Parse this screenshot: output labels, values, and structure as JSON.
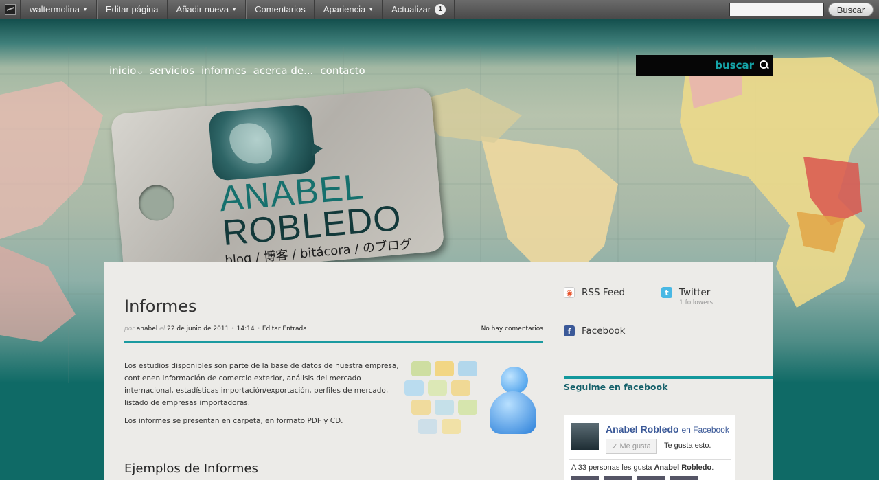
{
  "adminbar": {
    "user": "waltermolina",
    "items": [
      "Editar página",
      "Añadir nueva",
      "Comentarios",
      "Apariencia",
      "Actualizar"
    ],
    "update_count": "1",
    "search_button": "Buscar"
  },
  "nav": {
    "items": [
      "inicio",
      "servicios",
      "informes",
      "acerca de...",
      "contacto"
    ]
  },
  "search": {
    "label": "buscar"
  },
  "logo": {
    "line1": "ANABEL",
    "line2": "ROBLEDO",
    "tagline": "blog / 博客 / bitácora / のブログ"
  },
  "post": {
    "title": "Informes",
    "meta_by": "por",
    "author": "anabel",
    "meta_el": "el",
    "date": "22 de junio de 2011",
    "time": "14:14",
    "edit": "Editar Entrada",
    "comments": "No hay comentarios",
    "paragraph1": "Los estudios disponibles son parte de la base de datos de nuestra empresa, contienen información de comercio exterior, análisis del mercado internacional, estadísticas importación/exportación, perfiles de mercado, listado de empresas importadoras.",
    "paragraph2": "Los informes se presentan en carpeta, en formato PDF y CD.",
    "subheading": "Ejemplos de Informes"
  },
  "sidebar": {
    "rss": "RSS Feed",
    "twitter": "Twitter",
    "twitter_followers": "1 followers",
    "facebook": "Facebook",
    "fb_heading": "Seguime en facebook",
    "fb_page": "Anabel Robledo",
    "fb_en": "en Facebook",
    "fb_like": "Me gusta",
    "fb_te_gusta": "Te gusta esto.",
    "fb_count_prefix": "A 33 personas les gusta",
    "fb_count_name": "Anabel Robledo",
    "fb_count_suffix": "."
  },
  "colors": {
    "accent": "#1b9aa0",
    "brand": "#16706d",
    "facebook": "#3b5998"
  }
}
